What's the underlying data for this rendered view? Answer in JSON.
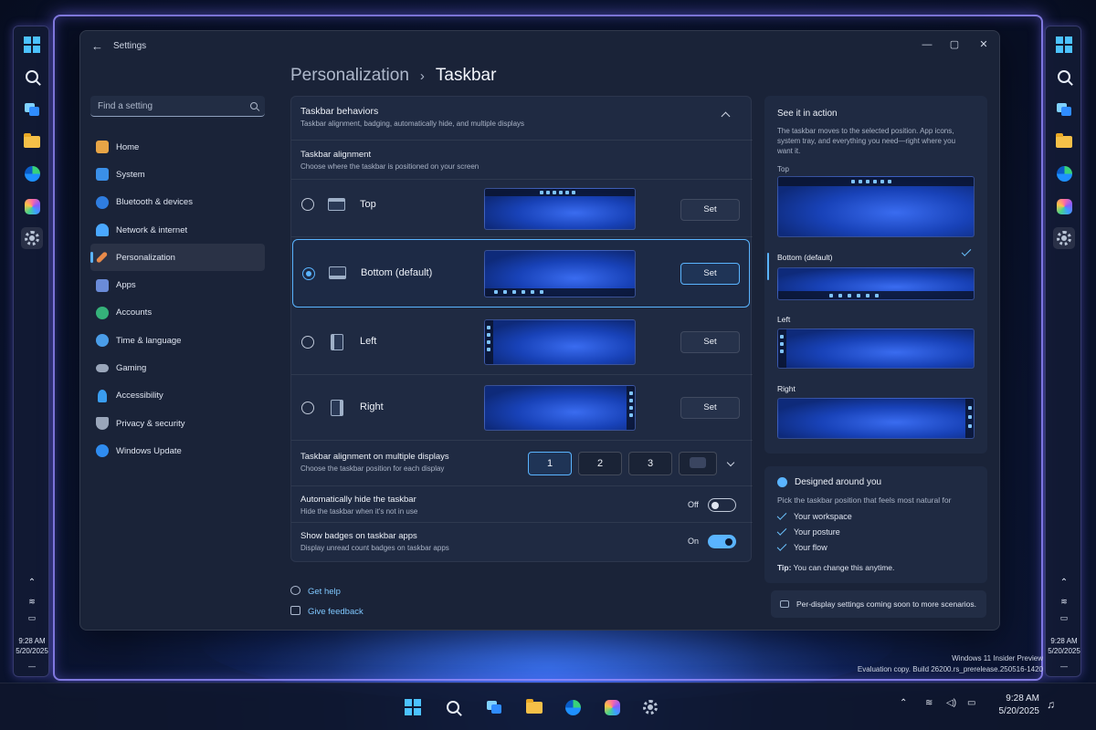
{
  "window": {
    "title": "Settings",
    "minimize": "—",
    "maximize": "▢",
    "close": "✕"
  },
  "search": {
    "placeholder": "Find a setting"
  },
  "nav": [
    {
      "label": "Home",
      "color": "#e8a546"
    },
    {
      "label": "System",
      "color": "#3a8fe8"
    },
    {
      "label": "Bluetooth & devices",
      "color": "#2f7de0"
    },
    {
      "label": "Network & internet",
      "color": "#4aa8ff"
    },
    {
      "label": "Personalization",
      "color": "#e88a4a"
    },
    {
      "label": "Apps",
      "color": "#6a8bd8"
    },
    {
      "label": "Accounts",
      "color": "#35b27a"
    },
    {
      "label": "Time & language",
      "color": "#4a9de8"
    },
    {
      "label": "Gaming",
      "color": "#9aa6ba"
    },
    {
      "label": "Accessibility",
      "color": "#3a9df0"
    },
    {
      "label": "Privacy & security",
      "color": "#9aa6ba"
    },
    {
      "label": "Windows Update",
      "color": "#2f8cf0"
    }
  ],
  "breadcrumb": {
    "parent": "Personalization",
    "separator": "›",
    "current": "Taskbar"
  },
  "behaviors": {
    "title": "Taskbar behaviors",
    "subtitle": "Taskbar alignment, badging, automatically hide, and multiple displays"
  },
  "alignment": {
    "title": "Taskbar alignment",
    "subtitle": "Choose where the taskbar is positioned on your screen"
  },
  "options": [
    {
      "label": "Top",
      "button": "Set",
      "selected": false
    },
    {
      "label": "Bottom (default)",
      "button": "Set",
      "selected": true
    },
    {
      "label": "Left",
      "button": "Set",
      "selected": false
    },
    {
      "label": "Right",
      "button": "Set",
      "selected": false
    }
  ],
  "multi": {
    "title": "Taskbar alignment on multiple displays",
    "subtitle": "Choose the taskbar position for each display",
    "displays": [
      "1",
      "2",
      "3"
    ],
    "selected": "1"
  },
  "autohide": {
    "title": "Automatically hide the taskbar",
    "subtitle": "Hide the taskbar when it's not in use",
    "state": "Off"
  },
  "badges": {
    "title": "Show badges on taskbar apps",
    "subtitle": "Display unread count badges on taskbar apps",
    "state": "On"
  },
  "links": {
    "help": "Get help",
    "feedback": "Give feedback"
  },
  "preview": {
    "title": "See it in action",
    "text": "The taskbar moves to the selected position. App icons, system tray, and everything you need—right where you want it.",
    "labels": [
      "Top",
      "Bottom (default)",
      "Left",
      "Right"
    ]
  },
  "designed": {
    "title": "Designed around you",
    "intro": "Pick the taskbar position that feels most natural for",
    "items": [
      "Your workspace",
      "Your posture",
      "Your flow"
    ],
    "tip_label": "Tip:",
    "tip_text": "You can change this anytime."
  },
  "notice": "Per-display settings coming soon to more scenarios.",
  "watermark": {
    "line1": "Windows 11 Insider Preview",
    "line2": "Evaluation copy. Build 26200.rs_prerelease.250516-1420"
  },
  "clock": {
    "time": "9:28 AM",
    "date": "5/20/2025"
  },
  "accent": "#5ab4ff"
}
